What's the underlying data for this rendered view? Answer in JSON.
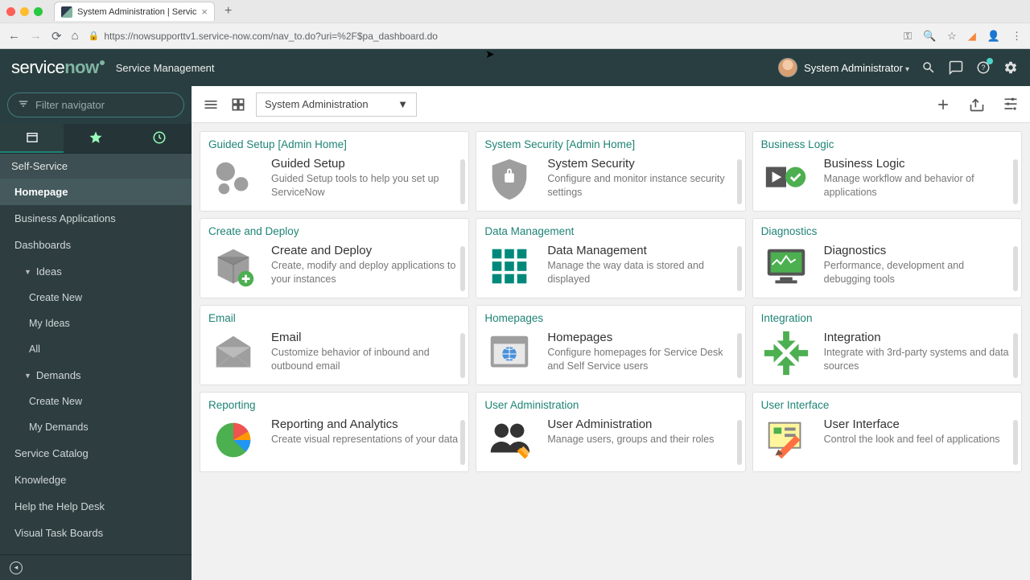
{
  "browser": {
    "tab_title": "System Administration | Servic",
    "url": "https://nowsupporttv1.service-now.com/nav_to.do?uri=%2F$pa_dashboard.do"
  },
  "banner": {
    "logo_left": "service",
    "logo_right": "now",
    "subtitle": "Service Management",
    "user": "System Administrator"
  },
  "sidebar": {
    "filter_placeholder": "Filter navigator",
    "items": [
      {
        "label": "Self-Service",
        "type": "group"
      },
      {
        "label": "Homepage",
        "type": "item",
        "active": true
      },
      {
        "label": "Business Applications",
        "type": "item"
      },
      {
        "label": "Dashboards",
        "type": "item"
      },
      {
        "label": "Ideas",
        "type": "disclosure"
      },
      {
        "label": "Create New",
        "type": "sub"
      },
      {
        "label": "My Ideas",
        "type": "sub"
      },
      {
        "label": "All",
        "type": "sub"
      },
      {
        "label": "Demands",
        "type": "disclosure"
      },
      {
        "label": "Create New",
        "type": "sub"
      },
      {
        "label": "My Demands",
        "type": "sub"
      },
      {
        "label": "Service Catalog",
        "type": "item"
      },
      {
        "label": "Knowledge",
        "type": "item"
      },
      {
        "label": "Help the Help Desk",
        "type": "item"
      },
      {
        "label": "Visual Task Boards",
        "type": "item"
      }
    ]
  },
  "toolbar": {
    "select_value": "System Administration"
  },
  "cards": [
    {
      "header": "Guided Setup [Admin Home]",
      "title": "Guided Setup",
      "desc": "Guided Setup tools to help you set up ServiceNow",
      "icon": "gears"
    },
    {
      "header": "System Security [Admin Home]",
      "title": "System Security",
      "desc": "Configure and monitor instance security settings",
      "icon": "shield"
    },
    {
      "header": "Business Logic",
      "title": "Business Logic",
      "desc": "Manage workflow and behavior of applications",
      "icon": "playcheck"
    },
    {
      "header": "Create and Deploy",
      "title": "Create and Deploy",
      "desc": "Create, modify and deploy applications to your instances",
      "icon": "box"
    },
    {
      "header": "Data Management",
      "title": "Data Management",
      "desc": "Manage the way data is stored and displayed",
      "icon": "grid"
    },
    {
      "header": "Diagnostics",
      "title": "Diagnostics",
      "desc": "Performance, development and debugging tools",
      "icon": "monitor"
    },
    {
      "header": "Email",
      "title": "Email",
      "desc": "Customize behavior of inbound and outbound email",
      "icon": "envelope"
    },
    {
      "header": "Homepages",
      "title": "Homepages",
      "desc": "Configure homepages for Service Desk and Self Service users",
      "icon": "browser"
    },
    {
      "header": "Integration",
      "title": "Integration",
      "desc": "Integrate with 3rd-party systems and data sources",
      "icon": "arrows"
    },
    {
      "header": "Reporting",
      "title": "Reporting and Analytics",
      "desc": "Create visual representations of your data",
      "icon": "pie"
    },
    {
      "header": "User Administration",
      "title": "User Administration",
      "desc": "Manage users, groups and their roles",
      "icon": "users"
    },
    {
      "header": "User Interface",
      "title": "User Interface",
      "desc": "Control the look and feel of applications",
      "icon": "palette"
    }
  ]
}
